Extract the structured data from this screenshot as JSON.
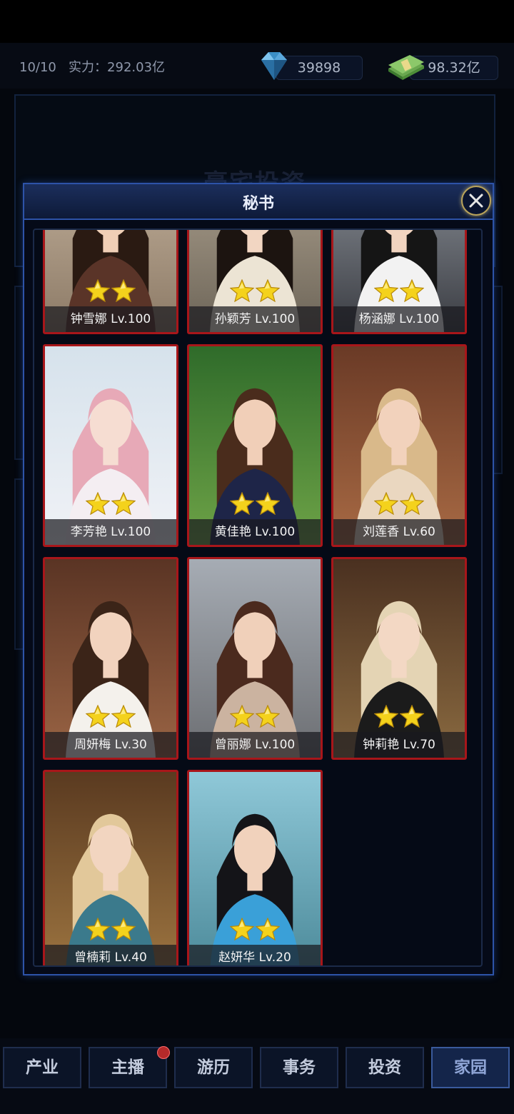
{
  "header": {
    "slots": "10/10",
    "power_label": "实力：",
    "power_value": "292.03亿",
    "gems": "39898",
    "cash": "98.32亿",
    "gem_icon": "diamond-icon",
    "cash_icon": "cash-stack-icon"
  },
  "background_panel": {
    "title": "豪宅投资"
  },
  "modal": {
    "title": "秘书",
    "close_icon": "close-icon",
    "cards": [
      {
        "name": "钟雪娜 Lv.100",
        "stars": 2,
        "hair": "#2a1a12",
        "top": "#5a3428",
        "bg1": "#cbb9a4",
        "bg2": "#8c7a66",
        "skin": "#f0cfb6"
      },
      {
        "name": "孙颖芳 Lv.100",
        "stars": 2,
        "hair": "#1c1410",
        "top": "#ece4d4",
        "bg1": "#b8ab98",
        "bg2": "#6d6558",
        "skin": "#f2d6c2"
      },
      {
        "name": "杨涵娜 Lv.100",
        "stars": 2,
        "hair": "#151515",
        "top": "#f2f2f2",
        "bg1": "#9aa0a8",
        "bg2": "#3a3c42",
        "skin": "#f1d4c0"
      },
      {
        "name": "李芳艳 Lv.100",
        "stars": 2,
        "hair": "#e7a9b7",
        "top": "#f4eef2",
        "bg1": "#d6e2ec",
        "bg2": "#f0f2f6",
        "skin": "#f6ddd2"
      },
      {
        "name": "黄佳艳 Lv.100",
        "stars": 2,
        "hair": "#4a2c1c",
        "top": "#1e2548",
        "bg1": "#2f6b2a",
        "bg2": "#6ea347",
        "skin": "#f1cfb8"
      },
      {
        "name": "刘莲香 Lv.60",
        "stars": 2,
        "hair": "#d9b98a",
        "top": "#ead7c0",
        "bg1": "#6a3a26",
        "bg2": "#a86a44",
        "skin": "#f2d2bc"
      },
      {
        "name": "周妍梅 Lv.30",
        "stars": 2,
        "hair": "#3b2418",
        "top": "#f4f1ec",
        "bg1": "#5a3424",
        "bg2": "#9a6444",
        "skin": "#f2d3be"
      },
      {
        "name": "曾丽娜 Lv.100",
        "stars": 2,
        "hair": "#4b2a1e",
        "top": "#cbb3a0",
        "bg1": "#a6acb4",
        "bg2": "#6c6e72",
        "skin": "#f0d0ba"
      },
      {
        "name": "钟莉艳 Lv.70",
        "stars": 2,
        "hair": "#e4d4b4",
        "top": "#1b1b1b",
        "bg1": "#4a3020",
        "bg2": "#8a6a40",
        "skin": "#f3d8c4"
      },
      {
        "name": "曾楠莉 Lv.40",
        "stars": 2,
        "hair": "#e2c89a",
        "top": "#3b7a8c",
        "bg1": "#5a3a20",
        "bg2": "#9c7440",
        "skin": "#f2d5c0"
      },
      {
        "name": "赵妍华 Lv.20",
        "stars": 2,
        "hair": "#141418",
        "top": "#3aa0d8",
        "bg1": "#8fc8d8",
        "bg2": "#4c8a9a",
        "skin": "#f1d2bc"
      }
    ]
  },
  "tabs": [
    {
      "label": "产业",
      "active": false
    },
    {
      "label": "主播",
      "active": false,
      "badge": true
    },
    {
      "label": "游历",
      "active": false
    },
    {
      "label": "事务",
      "active": false
    },
    {
      "label": "投资",
      "active": false
    },
    {
      "label": "家园",
      "active": true
    }
  ],
  "colors": {
    "accent_border": "#2d53a8",
    "card_border": "#a8161a",
    "star": "#f4d21c"
  }
}
